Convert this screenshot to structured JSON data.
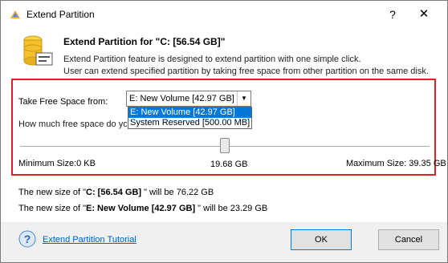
{
  "window": {
    "title": "Extend Partition",
    "help_label": "?",
    "close_label": "✕"
  },
  "header": {
    "title": "Extend Partition for \"C: [56.54 GB]\"",
    "description_line1": "Extend Partition feature is designed to extend partition with one simple click.",
    "description_line2": "User can extend specified partition by taking free space from other partition on the same disk."
  },
  "take_free_space": {
    "label": "Take Free Space from:",
    "selected": "E: New Volume [42.97 GB]",
    "options": [
      "E: New Volume [42.97 GB]",
      "System Reserved [500.00 MB]"
    ]
  },
  "how_much": {
    "label": "How much free space do you want to take?"
  },
  "slider": {
    "min_label": "Minimum Size:0 KB",
    "current_label": "19.68 GB",
    "max_label": "Maximum Size: 39.35 GB",
    "position_fraction": 0.5
  },
  "result": {
    "line1_prefix": "The new size of \"",
    "line1_partition": "C: [56.54 GB]",
    "line1_suffix": " \" will be 76.22 GB",
    "line2_prefix": "The new size of \"",
    "line2_partition": "E: New Volume [42.97 GB]",
    "line2_suffix": " \" will be 23.29 GB"
  },
  "footer": {
    "tutorial_link": "Extend Partition Tutorial",
    "ok_label": "OK",
    "cancel_label": "Cancel"
  },
  "colors": {
    "highlight_border": "#e0202a",
    "selection": "#0078d7",
    "link": "#0060c0"
  }
}
